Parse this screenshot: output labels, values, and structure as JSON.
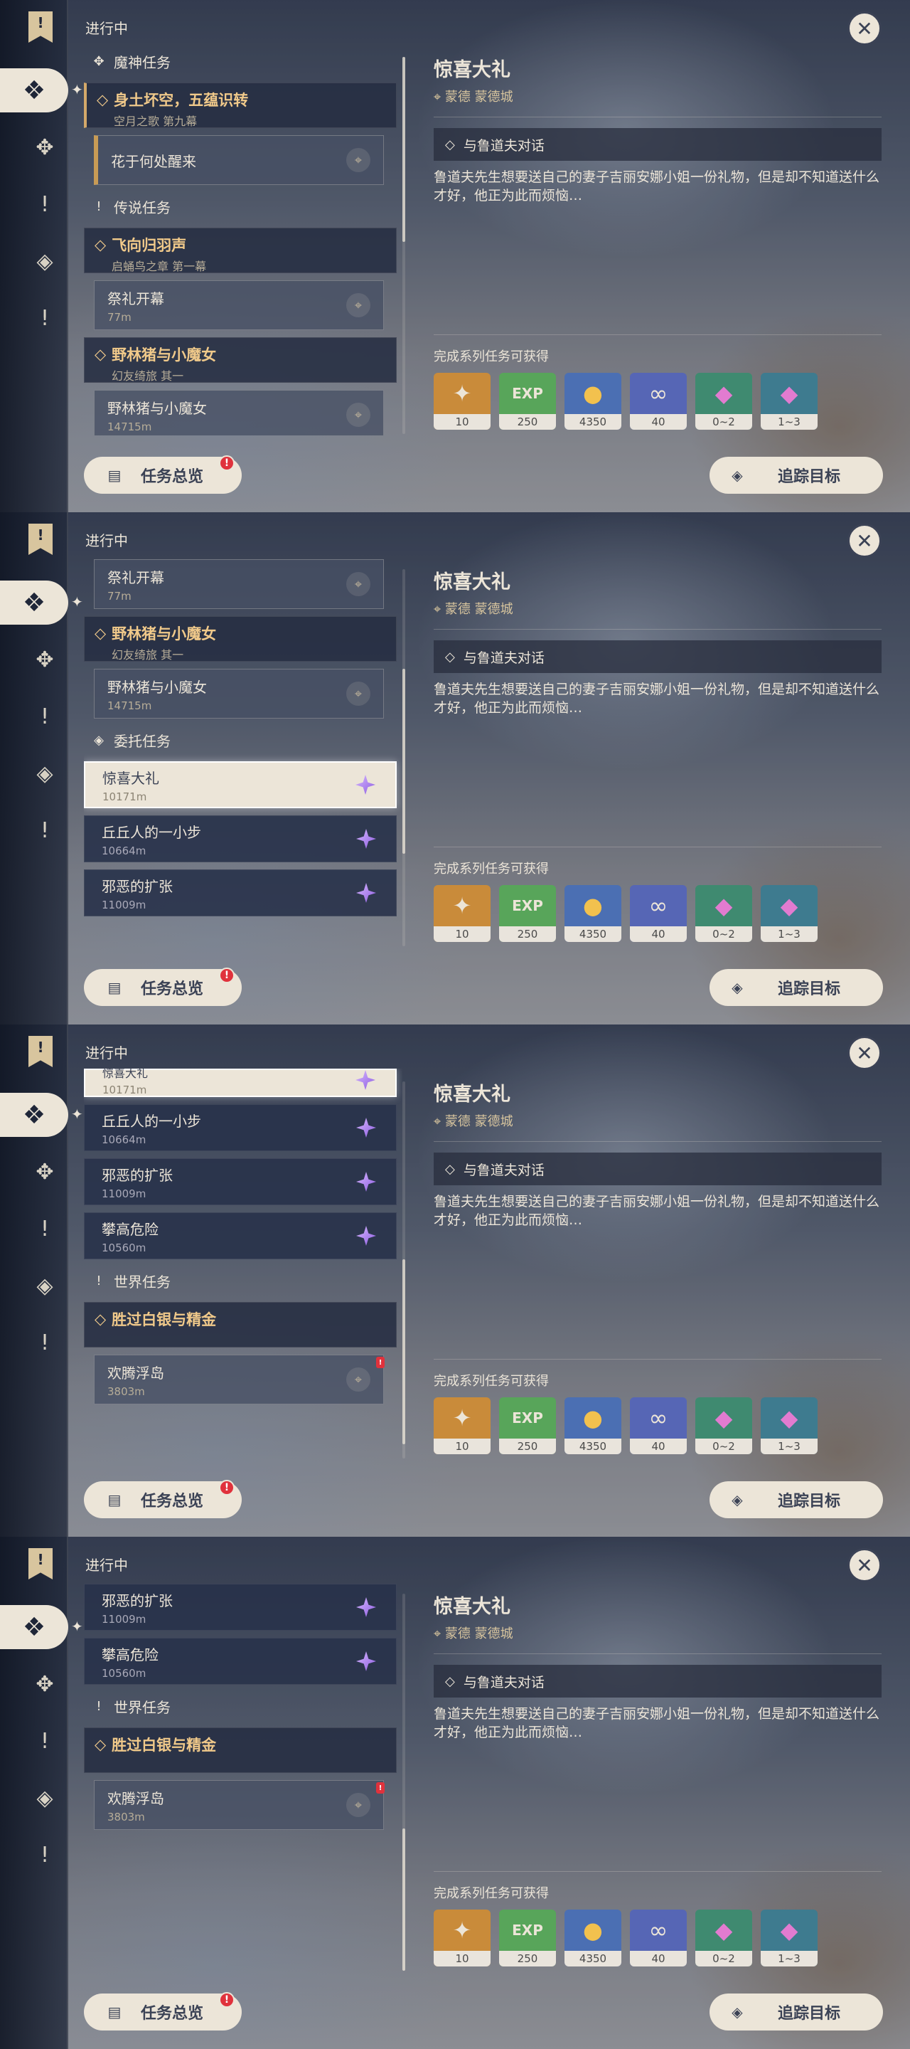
{
  "status": "进行中",
  "icons": {
    "close": "close-icon",
    "bookmark": "bookmark-icon",
    "archon": "archon-quest-icon",
    "story": "story-quest-icon",
    "commission": "commission-icon",
    "world": "world-quest-icon",
    "location": "location-pin-icon"
  },
  "sidebar": {
    "exclamation": "!"
  },
  "detail": {
    "title": "惊喜大礼",
    "location": "蒙德 蒙德城",
    "objective": "与鲁道夫对话",
    "description": "鲁道夫先生想要送自己的妻子吉丽安娜小姐一份礼物，但是却不知道送什么才好，他正为此而烦恼…",
    "rewards_label": "完成系列任务可获得",
    "rewards": [
      {
        "name": "primogem",
        "count": "10",
        "color": "#c98b3a",
        "glyph": "✦"
      },
      {
        "name": "adventure-exp",
        "count": "250",
        "color": "#58a55a",
        "glyph": "EXP"
      },
      {
        "name": "mora",
        "count": "4350",
        "color": "#4b6fb3",
        "glyph": "●"
      },
      {
        "name": "friendship-exp",
        "count": "40",
        "color": "#5666b5",
        "glyph": "∞"
      },
      {
        "name": "enhancement-ore",
        "count": "0~2",
        "color": "#3f8a70",
        "glyph": "◆"
      },
      {
        "name": "crystal-cluster",
        "count": "1~3",
        "color": "#3e7b8f",
        "glyph": "◆"
      }
    ]
  },
  "buttons": {
    "overview": "任务总览",
    "track": "追踪目标",
    "close": "✕"
  },
  "categories": {
    "archon": "魔神任务",
    "story": "传说任务",
    "commission": "委托任务",
    "world": "世界任务"
  },
  "quests": {
    "archon_parent": {
      "title": "身土坏空，五蕴识转",
      "sub": "空月之歌 第九幕"
    },
    "archon_child": {
      "title": "花于何处醒来"
    },
    "story1_parent": {
      "title": "飞向归羽声",
      "sub": "启蛹鸟之章 第一幕"
    },
    "story1_child": {
      "title": "祭礼开幕",
      "dist": "77m"
    },
    "story2_parent": {
      "title": "野林猪与小魔女",
      "sub": "幻友绮旅 其一"
    },
    "story2_child": {
      "title": "野林猪与小魔女",
      "dist": "14715m"
    },
    "c1": {
      "title": "惊喜大礼",
      "dist": "10171m"
    },
    "c2": {
      "title": "丘丘人的一小步",
      "dist": "10664m"
    },
    "c3": {
      "title": "邪恶的扩张",
      "dist": "11009m"
    },
    "c4": {
      "title": "攀高危险",
      "dist": "10560m"
    },
    "world_parent": {
      "title": "胜过白银与精金"
    },
    "world_child": {
      "title": "欢腾浮岛",
      "dist": "3803m"
    }
  },
  "panels": [
    {
      "scroll_index": 1
    },
    {
      "scroll_index": 2
    },
    {
      "scroll_index": 3
    },
    {
      "scroll_index": 4
    }
  ]
}
